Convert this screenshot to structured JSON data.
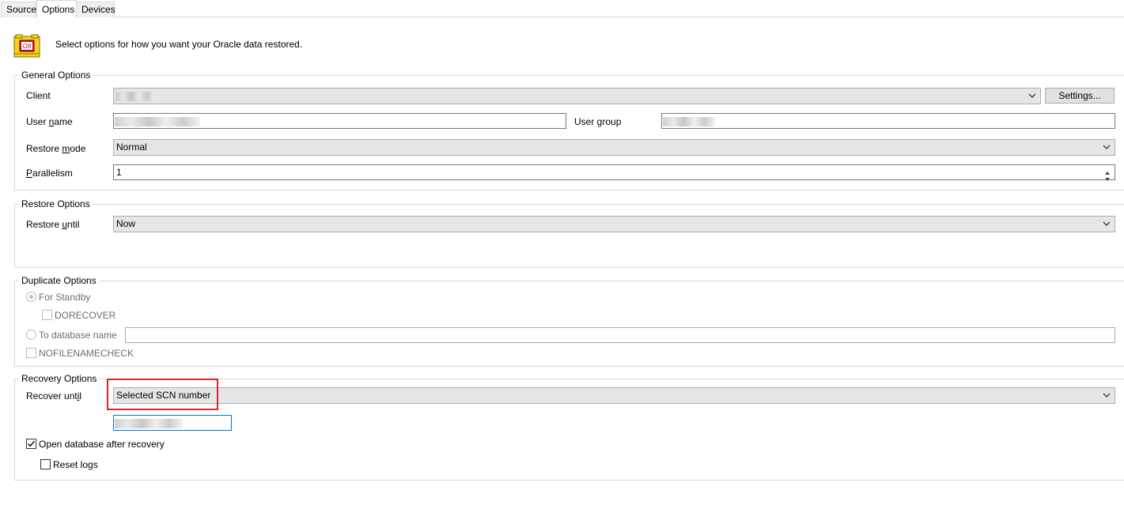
{
  "tabs": [
    {
      "label": "Source"
    },
    {
      "label": "Options"
    },
    {
      "label": "Devices"
    }
  ],
  "header": {
    "text": "Select options for how you want your Oracle data restored."
  },
  "general": {
    "legend": "General Options",
    "client_label": "Client",
    "client_value": "",
    "settings_label": "Settings...",
    "user_name_label": "User name",
    "user_name_value": "",
    "user_group_label": "User group",
    "user_group_value": "",
    "restore_mode_label": "Restore mode",
    "restore_mode_value": "Normal",
    "parallelism_label": "Parallelism",
    "parallelism_value": "1"
  },
  "restore": {
    "legend": "Restore Options",
    "restore_until_label": "Restore until",
    "restore_until_value": "Now"
  },
  "duplicate": {
    "legend": "Duplicate Options",
    "for_standby_label": "For Standby",
    "dorecover_label": "DORECOVER",
    "to_database_label": "To database name",
    "to_database_value": "",
    "nofilenamecheck_label": "NOFILENAMECHECK"
  },
  "recovery": {
    "legend": "Recovery Options",
    "recover_until_label": "Recover until",
    "recover_until_value": "Selected SCN number",
    "scn_value": "",
    "open_db_label": "Open database after recovery",
    "open_db_checked": true,
    "reset_logs_label": "Reset logs",
    "reset_logs_checked": false
  },
  "colors": {
    "highlight": "#e0222c",
    "focus_border": "#0078d7",
    "icon_yellow": "#f5d21f",
    "icon_red": "#c8102e"
  }
}
